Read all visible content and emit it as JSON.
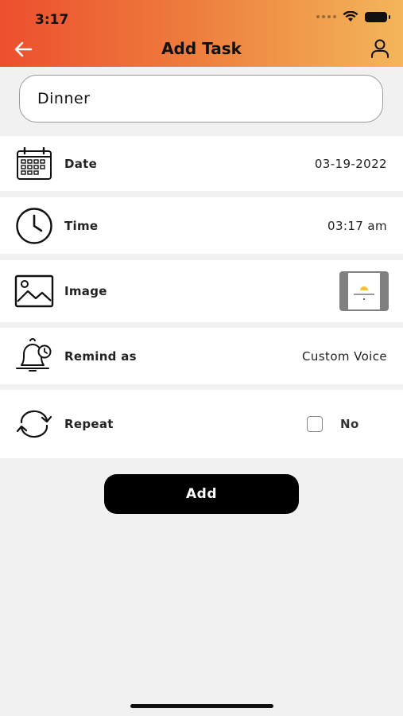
{
  "status_bar": {
    "time": "3:17"
  },
  "header": {
    "title": "Add Task",
    "back_icon": "arrow-left-icon",
    "profile_icon": "user-icon",
    "gradient_start": "#ec4f2e",
    "gradient_end": "#f3b65a"
  },
  "task_input": {
    "value": "Dinner",
    "placeholder": ""
  },
  "rows": {
    "date": {
      "label": "Date",
      "value": "03-19-2022",
      "icon": "calendar-icon"
    },
    "time": {
      "label": "Time",
      "value": "03:17 am",
      "icon": "clock-icon"
    },
    "image": {
      "label": "Image",
      "icon": "image-icon"
    },
    "remind": {
      "label": "Remind as",
      "value": "Custom Voice",
      "icon": "bell-clock-icon"
    },
    "repeat": {
      "label": "Repeat",
      "value": "No",
      "checked": false,
      "icon": "repeat-icon"
    }
  },
  "add_button": {
    "label": "Add"
  }
}
